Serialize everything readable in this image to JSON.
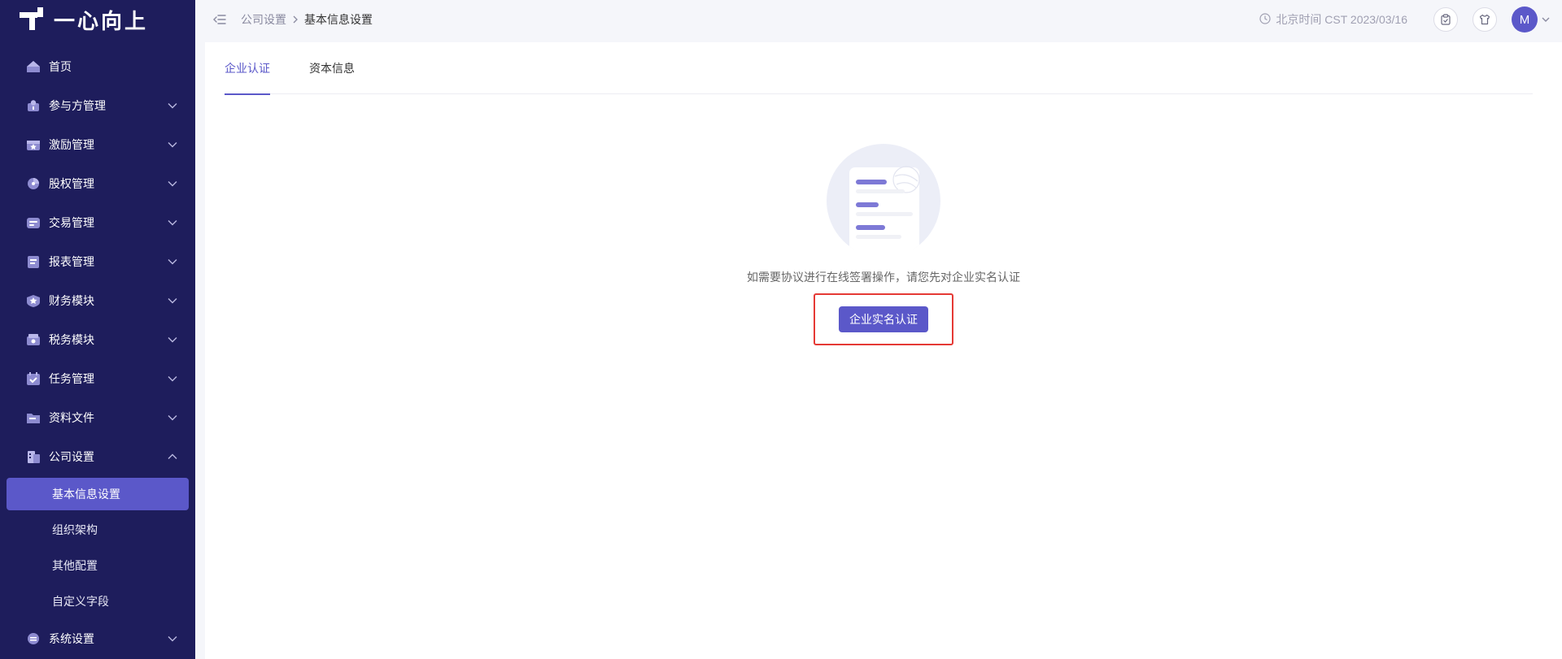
{
  "brand": {
    "name": "一心向上"
  },
  "sidebar": {
    "items": [
      {
        "label": "首页",
        "icon": "home-icon",
        "expandable": false
      },
      {
        "label": "参与方管理",
        "icon": "participants-icon",
        "expandable": true
      },
      {
        "label": "激励管理",
        "icon": "incentive-icon",
        "expandable": true
      },
      {
        "label": "股权管理",
        "icon": "equity-icon",
        "expandable": true
      },
      {
        "label": "交易管理",
        "icon": "trade-icon",
        "expandable": true
      },
      {
        "label": "报表管理",
        "icon": "report-icon",
        "expandable": true
      },
      {
        "label": "财务模块",
        "icon": "finance-icon",
        "expandable": true
      },
      {
        "label": "税务模块",
        "icon": "tax-icon",
        "expandable": true
      },
      {
        "label": "任务管理",
        "icon": "task-icon",
        "expandable": true
      },
      {
        "label": "资料文件",
        "icon": "folder-icon",
        "expandable": true
      },
      {
        "label": "公司设置",
        "icon": "company-icon",
        "expandable": true,
        "expanded": true,
        "children": [
          "基本信息设置",
          "组织架构",
          "其他配置",
          "自定义字段"
        ],
        "active_child": 0
      },
      {
        "label": "系统设置",
        "icon": "system-icon",
        "expandable": true
      }
    ]
  },
  "topbar": {
    "breadcrumb": {
      "parent": "公司设置",
      "current": "基本信息设置"
    },
    "clock_text": "北京时间 CST 2023/03/16",
    "avatar_initial": "M"
  },
  "tabs": [
    {
      "label": "企业认证",
      "active": true
    },
    {
      "label": "资本信息",
      "active": false
    }
  ],
  "empty_state": {
    "message": "如需要协议进行在线签署操作，请您先对企业实名认证",
    "button_label": "企业实名认证"
  },
  "colors": {
    "sidebar_bg": "#1e1d5c",
    "accent": "#5b58c9",
    "highlight_border": "#e53935"
  }
}
